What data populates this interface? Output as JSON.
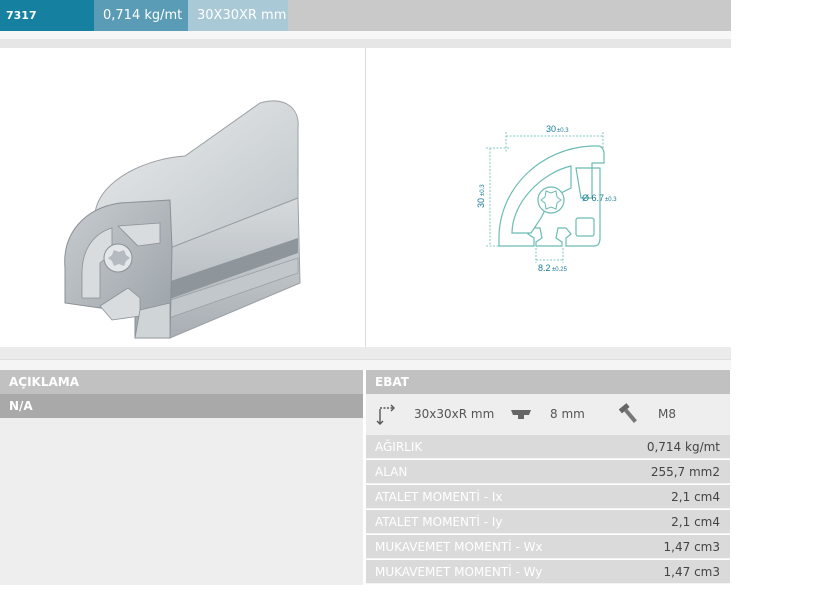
{
  "header": {
    "code": "7317",
    "weight": "0,714 kg/mt",
    "size": "30X30XR mm"
  },
  "drawing": {
    "width_label": "30",
    "width_tol": "±0.3",
    "height_label": "30",
    "height_tol": "±0.3",
    "hole_label": "Ø 6.7",
    "hole_tol": "±0.3",
    "slot_label": "8.2",
    "slot_tol": "±0.25"
  },
  "description": {
    "heading": "AÇIKLAMA",
    "value": "N/A"
  },
  "dimensions": {
    "heading": "EBAT",
    "profile_size": "30x30xR mm",
    "slot_size": "8 mm",
    "bolt": "M8"
  },
  "specs": [
    {
      "label": "AĞIRLIK",
      "value": "0,714 kg/mt"
    },
    {
      "label": "ALAN",
      "value": "255,7 mm2"
    },
    {
      "label": "ATALET MOMENTİ - Ix",
      "value": "2,1 cm4"
    },
    {
      "label": "ATALET MOMENTİ - Iy",
      "value": "2,1 cm4"
    },
    {
      "label": "MUKAVEMET MOMENTİ - Wx",
      "value": "1,47 cm3"
    },
    {
      "label": "MUKAVEMET MOMENTİ - Wy",
      "value": "1,47 cm3"
    }
  ],
  "colors": {
    "code_bg": "#1680a0",
    "weight_bg": "#5a9cb5",
    "size_bg": "#a9c9d7",
    "drawing_line": "#5fb8b0",
    "dim_text": "#1a7a95"
  }
}
